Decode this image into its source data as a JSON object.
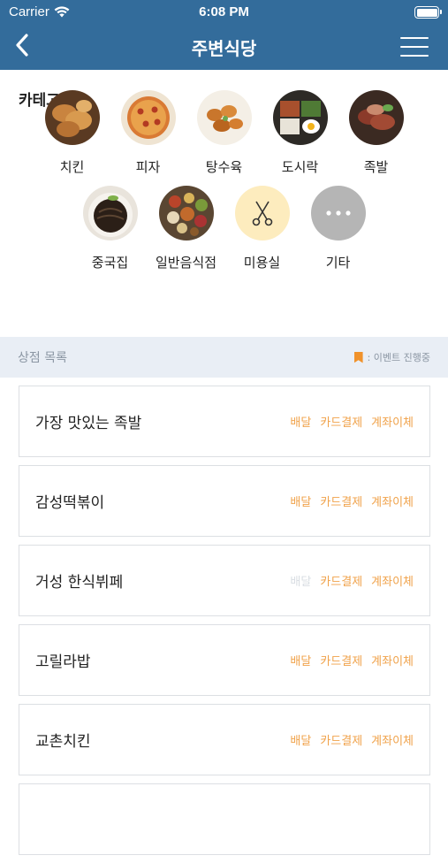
{
  "status": {
    "carrier": "Carrier",
    "time": "6:08 PM"
  },
  "nav": {
    "title": "주변식당"
  },
  "category": {
    "title": "카테고리",
    "items": [
      {
        "label": "치킨",
        "icon": "chicken-photo"
      },
      {
        "label": "피자",
        "icon": "pizza-photo"
      },
      {
        "label": "탕수육",
        "icon": "tangsuyuk-photo"
      },
      {
        "label": "도시락",
        "icon": "lunchbox-photo"
      },
      {
        "label": "족발",
        "icon": "jokbal-photo"
      },
      {
        "label": "중국집",
        "icon": "chinese-food-photo"
      },
      {
        "label": "일반음식점",
        "icon": "korean-food-photo"
      },
      {
        "label": "미용실",
        "icon": "scissors-icon"
      },
      {
        "label": "기타",
        "icon": "more-icon"
      }
    ]
  },
  "list": {
    "title": "상점 목록",
    "legend": ": 이벤트 진행중",
    "stores": [
      {
        "name": "가장 맛있는 족발",
        "tags": [
          "배달",
          "카드결제",
          "계좌이체"
        ],
        "delivery": true
      },
      {
        "name": "감성떡볶이",
        "tags": [
          "배달",
          "카드결제",
          "계좌이체"
        ],
        "delivery": true
      },
      {
        "name": "거성 한식뷔페",
        "tags": [
          "배달",
          "카드결제",
          "계좌이체"
        ],
        "delivery": false
      },
      {
        "name": "고릴라밥",
        "tags": [
          "배달",
          "카드결제",
          "계좌이체"
        ],
        "delivery": true
      },
      {
        "name": "교촌치킨",
        "tags": [
          "배달",
          "카드결제",
          "계좌이체"
        ],
        "delivery": true
      }
    ]
  },
  "colors": {
    "header": "#336c9b",
    "tag": "#f0a24a",
    "tag_off": "#d8dde2",
    "event": "#f0922b"
  }
}
